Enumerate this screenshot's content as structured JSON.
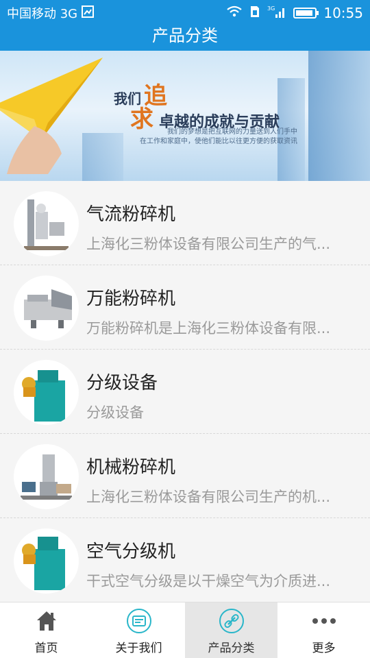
{
  "status_bar": {
    "carrier": "中国移动 3G",
    "network": "3G",
    "time": "10:55"
  },
  "title_bar": {
    "title": "产品分类"
  },
  "banner": {
    "headline_line1_prefix": "我们",
    "headline_line1_emphasis": "追",
    "headline_line2_emphasis": "求",
    "headline_line2_text": "卓越的成就与贡献",
    "tagline_line1": "我们的梦想是把互联网的力量送到人们手中",
    "tagline_line2": "在工作和家庭中，使他们能比以往更方便的获取资讯"
  },
  "products": [
    {
      "name": "气流粉碎机",
      "desc": "上海化三粉体设备有限公司生产的气..."
    },
    {
      "name": "万能粉碎机",
      "desc": "万能粉碎机是上海化三粉体设备有限..."
    },
    {
      "name": "分级设备",
      "desc": "分级设备"
    },
    {
      "name": "机械粉碎机",
      "desc": "上海化三粉体设备有限公司生产的机..."
    },
    {
      "name": "空气分级机",
      "desc": "干式空气分级是以干燥空气为介质进..."
    }
  ],
  "tabs": [
    {
      "label": "首页",
      "icon": "home-icon"
    },
    {
      "label": "关于我们",
      "icon": "about-icon"
    },
    {
      "label": "产品分类",
      "icon": "link-icon",
      "active": true
    },
    {
      "label": "更多",
      "icon": "more-icon"
    }
  ],
  "colors": {
    "header_blue": "#1a93dc",
    "accent_orange": "#e0751f",
    "tab_teal": "#29b6c9"
  }
}
